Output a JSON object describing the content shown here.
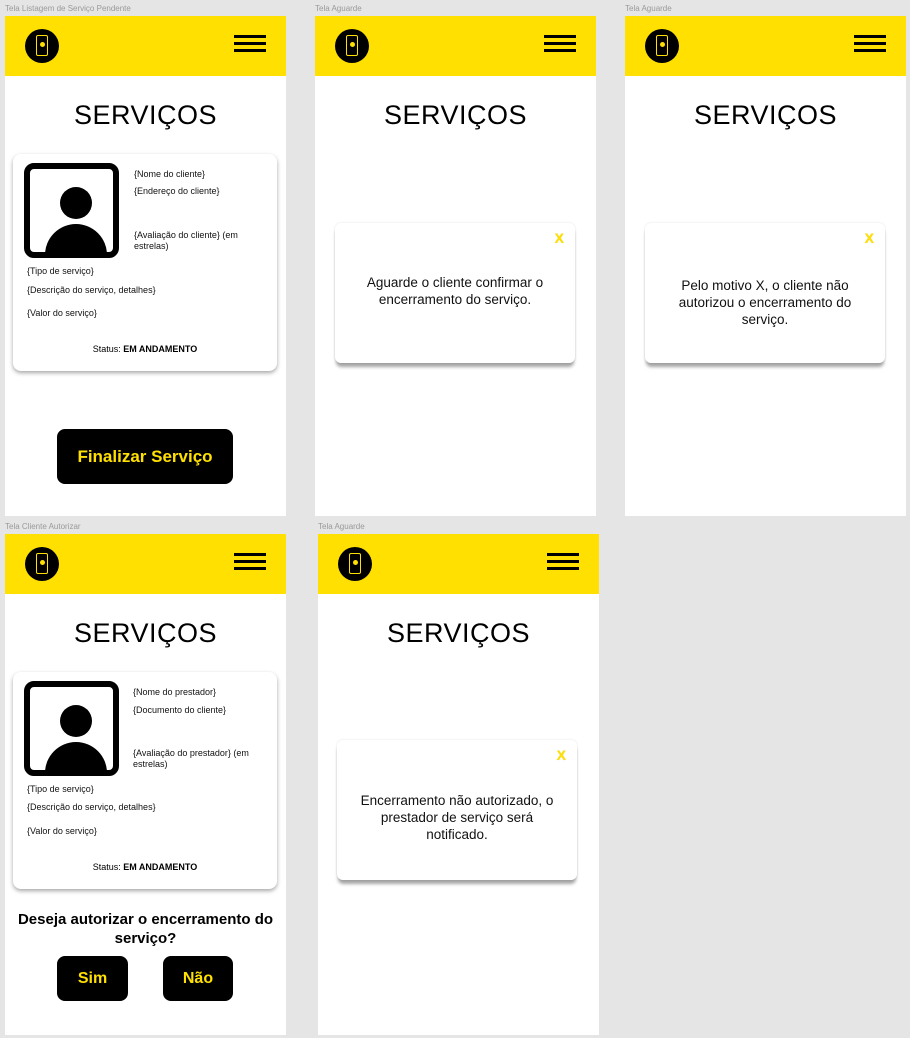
{
  "frames": [
    {
      "label": "Tela Listagem de Serviço Pendente"
    },
    {
      "label": "Tela Aguarde"
    },
    {
      "label": "Tela Aguarde"
    },
    {
      "label": "Tela Cliente Autorizar"
    },
    {
      "label": "Tela Aguarde"
    }
  ],
  "page_title": "SERVIÇOS",
  "icons": {
    "logo": "phone-robot-logo",
    "menu": "hamburger-menu-icon",
    "avatar": "user-avatar-icon",
    "close": "close-x-icon"
  },
  "colors": {
    "brand": "#FFE000",
    "dark": "#000000",
    "background": "#E5E5E5"
  },
  "screen1": {
    "card": {
      "name": "{Nome do cliente}",
      "address": "{Endereço do cliente}",
      "rating": "{Avaliação do cliente} (em estrelas)",
      "service_type": "{Tipo de serviço}",
      "description": "{Descrição do serviço, detalhes}",
      "value": "{Valor do serviço}",
      "status_label": "Status:",
      "status_value": "EM ANDAMENTO"
    },
    "finish_button": "Finalizar Serviço"
  },
  "screen2": {
    "close": "X",
    "message": "Aguarde o cliente confirmar o encerramento do serviço."
  },
  "screen3": {
    "close": "X",
    "message": "Pelo motivo X, o cliente não autorizou o encerramento do serviço."
  },
  "screen4": {
    "card": {
      "name": "{Nome do prestador}",
      "document": "{Documento do cliente}",
      "rating": "{Avaliação do prestador} (em estrelas)",
      "service_type": "{Tipo de serviço}",
      "description": "{Descrição do serviço, detalhes}",
      "value": "{Valor do serviço}",
      "status_label": "Status:",
      "status_value": "EM ANDAMENTO"
    },
    "question": "Deseja autorizar o encerramento do serviço?",
    "yes_button": "Sim",
    "no_button": "Não"
  },
  "screen5": {
    "close": "X",
    "message": "Encerramento não autorizado, o prestador de serviço será notificado."
  }
}
